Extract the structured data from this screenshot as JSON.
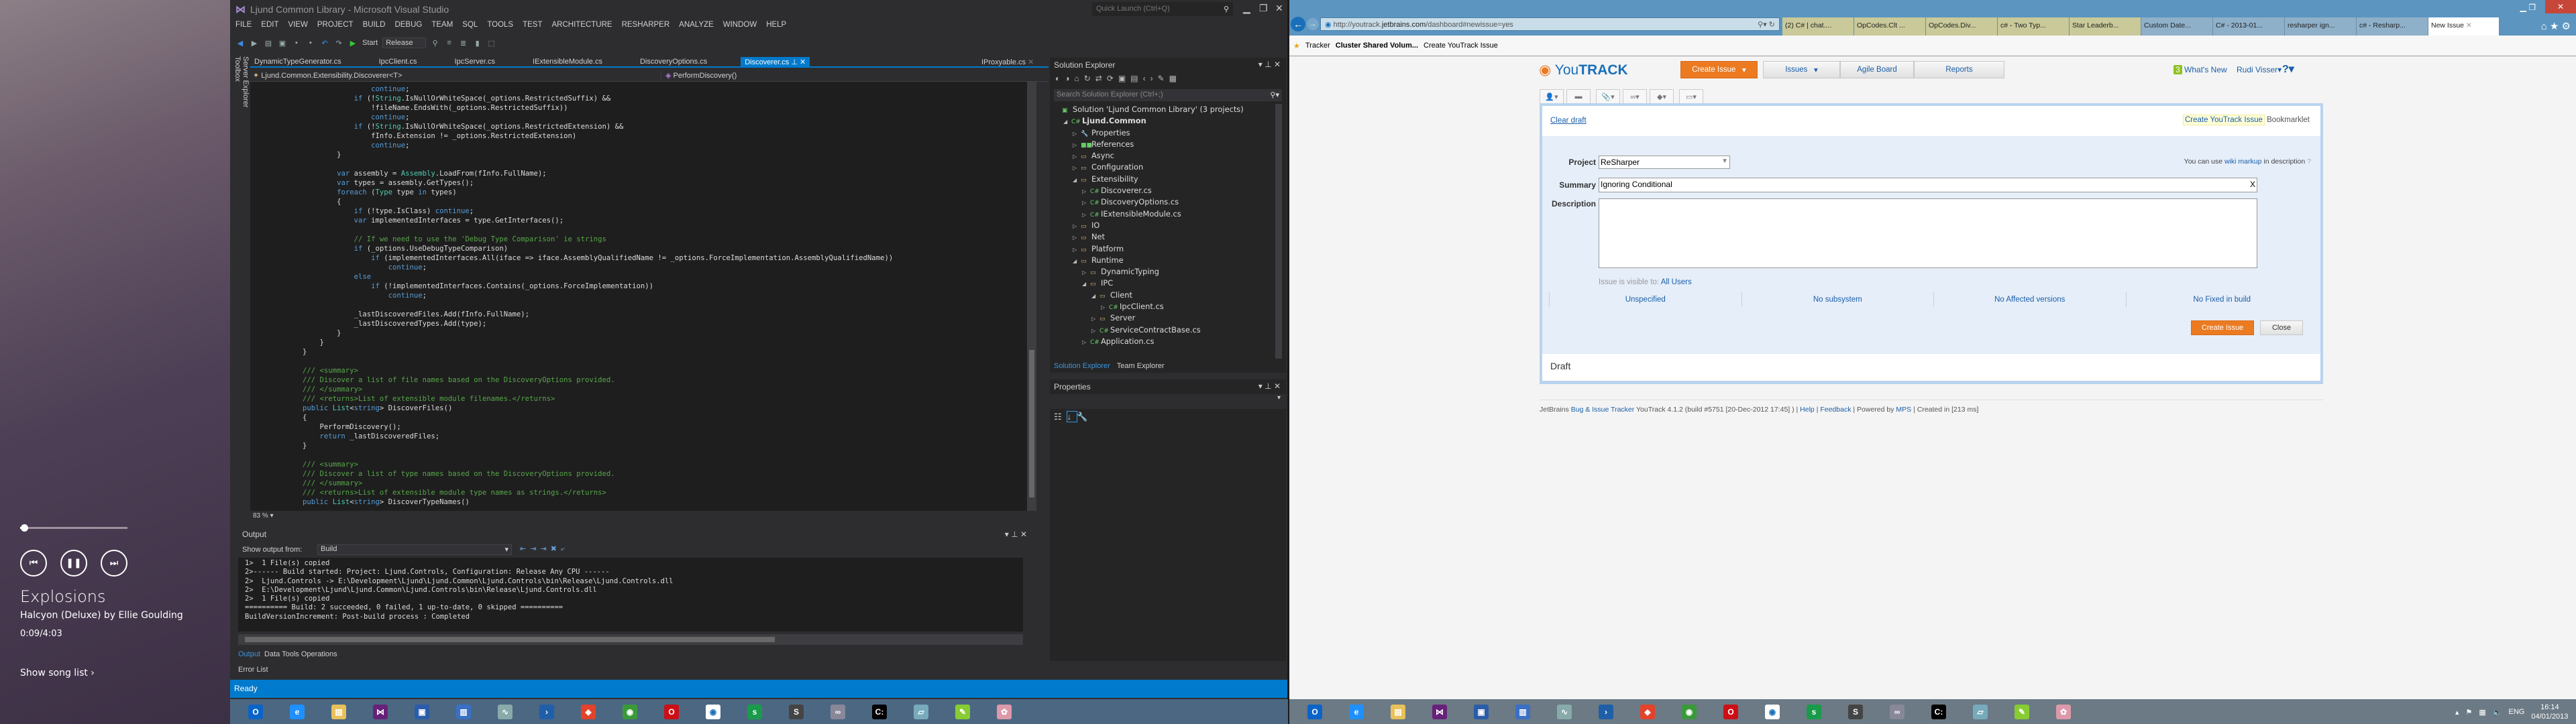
{
  "media": {
    "song": "Explosions",
    "album_line": "Halcyon (Deluxe) by Ellie Goulding",
    "time": "0:09/4:03",
    "progress_fraction": 0.037,
    "show_song_list": "Show song list ›",
    "prev_icon": "skip-previous-icon",
    "pause_icon": "pause-icon",
    "next_icon": "skip-next-icon"
  },
  "vs": {
    "title": "Ljund Common Library - Microsoft Visual Studio",
    "quick_launch": "Quick Launch (Ctrl+Q)",
    "menu": [
      "FILE",
      "EDIT",
      "VIEW",
      "PROJECT",
      "BUILD",
      "DEBUG",
      "TEAM",
      "SQL",
      "TOOLS",
      "TEST",
      "ARCHITECTURE",
      "RESHARPER",
      "ANALYZE",
      "WINDOW",
      "HELP"
    ],
    "toolbar": {
      "start": "Start",
      "config": "Release"
    },
    "side_tabs": [
      "Toolbox",
      "Server Explorer"
    ],
    "doc_tabs": [
      "DynamicTypeGenerator.cs",
      "IpcClient.cs",
      "IpcServer.cs",
      "IExtensibleModule.cs",
      "DiscoveryOptions.cs",
      "Discoverer.cs"
    ],
    "active_tab": "Discoverer.cs",
    "pinned_tab": "IProxyable.cs",
    "nav_type": "Ljund.Common.Extensibility.Discoverer<T>",
    "nav_member": "PerformDiscovery()",
    "zoom": "83 %",
    "status": "Ready"
  },
  "editor": {
    "lines": [
      {
        "i": 6,
        "tokens": [
          [
            "k",
            "continue"
          ],
          [
            "p",
            ";"
          ]
        ]
      },
      {
        "i": 5,
        "tokens": [
          [
            "k",
            "if"
          ],
          [
            "p",
            " (!"
          ],
          [
            "t",
            "String"
          ],
          [
            "p",
            ".IsNullOrWhiteSpace(_options.RestrictedSuffix) &&"
          ]
        ]
      },
      {
        "i": 6,
        "tokens": [
          [
            "p",
            "!fileName.EndsWith(_options.RestrictedSuffix))"
          ]
        ]
      },
      {
        "i": 6,
        "tokens": [
          [
            "k",
            "continue"
          ],
          [
            "p",
            ";"
          ]
        ]
      },
      {
        "i": 5,
        "tokens": [
          [
            "k",
            "if"
          ],
          [
            "p",
            " (!"
          ],
          [
            "t",
            "String"
          ],
          [
            "p",
            ".IsNullOrWhiteSpace(_options.RestrictedExtension) &&"
          ]
        ]
      },
      {
        "i": 6,
        "tokens": [
          [
            "p",
            "fInfo.Extension != _options.RestrictedExtension)"
          ]
        ]
      },
      {
        "i": 6,
        "tokens": [
          [
            "k",
            "continue"
          ],
          [
            "p",
            ";"
          ]
        ]
      },
      {
        "i": 4,
        "tokens": [
          [
            "p",
            "}"
          ]
        ]
      },
      {
        "i": 0,
        "tokens": []
      },
      {
        "i": 4,
        "tokens": [
          [
            "k",
            "var"
          ],
          [
            "p",
            " assembly = "
          ],
          [
            "t",
            "Assembly"
          ],
          [
            "p",
            ".LoadFrom(fInfo.FullName);"
          ]
        ]
      },
      {
        "i": 4,
        "tokens": [
          [
            "k",
            "var"
          ],
          [
            "p",
            " types = assembly.GetTypes();"
          ]
        ]
      },
      {
        "i": 4,
        "tokens": [
          [
            "k",
            "foreach"
          ],
          [
            "p",
            " ("
          ],
          [
            "t",
            "Type"
          ],
          [
            "p",
            " type "
          ],
          [
            "k",
            "in"
          ],
          [
            "p",
            " types)"
          ]
        ]
      },
      {
        "i": 4,
        "tokens": [
          [
            "p",
            "{"
          ]
        ]
      },
      {
        "i": 5,
        "tokens": [
          [
            "k",
            "if"
          ],
          [
            "p",
            " (!type.IsClass) "
          ],
          [
            "k",
            "continue"
          ],
          [
            "p",
            ";"
          ]
        ]
      },
      {
        "i": 5,
        "tokens": [
          [
            "k",
            "var"
          ],
          [
            "p",
            " implementedInterfaces = type.GetInterfaces();"
          ]
        ]
      },
      {
        "i": 0,
        "tokens": []
      },
      {
        "i": 5,
        "tokens": [
          [
            "c",
            "// If we need to use the 'Debug Type Comparison' ie strings"
          ]
        ]
      },
      {
        "i": 5,
        "tokens": [
          [
            "k",
            "if"
          ],
          [
            "p",
            " (_options.UseDebugTypeComparison)"
          ]
        ]
      },
      {
        "i": 6,
        "tokens": [
          [
            "k",
            "if"
          ],
          [
            "p",
            " (implementedInterfaces.All(iface => iface.AssemblyQualifiedName != _options.ForceImplementation.AssemblyQualifiedName))"
          ]
        ]
      },
      {
        "i": 7,
        "tokens": [
          [
            "k",
            "continue"
          ],
          [
            "p",
            ";"
          ]
        ]
      },
      {
        "i": 5,
        "tokens": [
          [
            "k",
            "else"
          ]
        ]
      },
      {
        "i": 6,
        "tokens": [
          [
            "k",
            "if"
          ],
          [
            "p",
            " (!implementedInterfaces.Contains(_options.ForceImplementation))"
          ]
        ]
      },
      {
        "i": 7,
        "tokens": [
          [
            "k",
            "continue"
          ],
          [
            "p",
            ";"
          ]
        ]
      },
      {
        "i": 0,
        "tokens": []
      },
      {
        "i": 5,
        "tokens": [
          [
            "p",
            "_lastDiscoveredFiles.Add(fInfo.FullName);"
          ]
        ]
      },
      {
        "i": 5,
        "tokens": [
          [
            "p",
            "_lastDiscoveredTypes.Add(type);"
          ]
        ]
      },
      {
        "i": 4,
        "tokens": [
          [
            "p",
            "}"
          ]
        ]
      },
      {
        "i": 3,
        "tokens": [
          [
            "p",
            "}"
          ]
        ]
      },
      {
        "i": 2,
        "tokens": [
          [
            "p",
            "}"
          ]
        ]
      },
      {
        "i": 0,
        "tokens": []
      },
      {
        "i": 2,
        "tokens": [
          [
            "c",
            "/// <summary>"
          ]
        ]
      },
      {
        "i": 2,
        "tokens": [
          [
            "c",
            "/// Discover a list of file names based on the DiscoveryOptions provided."
          ]
        ]
      },
      {
        "i": 2,
        "tokens": [
          [
            "c",
            "/// </summary>"
          ]
        ]
      },
      {
        "i": 2,
        "tokens": [
          [
            "c",
            "/// <returns>List of extensible module filenames.</returns>"
          ]
        ]
      },
      {
        "i": 2,
        "tokens": [
          [
            "k",
            "public"
          ],
          [
            "p",
            " "
          ],
          [
            "t",
            "List"
          ],
          [
            "p",
            "<"
          ],
          [
            "k",
            "string"
          ],
          [
            "p",
            "> DiscoverFiles()"
          ]
        ]
      },
      {
        "i": 2,
        "tokens": [
          [
            "p",
            "{"
          ]
        ]
      },
      {
        "i": 3,
        "tokens": [
          [
            "p",
            "PerformDiscovery();"
          ]
        ]
      },
      {
        "i": 3,
        "tokens": [
          [
            "k",
            "return"
          ],
          [
            "p",
            " _lastDiscoveredFiles;"
          ]
        ]
      },
      {
        "i": 2,
        "tokens": [
          [
            "p",
            "}"
          ]
        ]
      },
      {
        "i": 0,
        "tokens": []
      },
      {
        "i": 2,
        "tokens": [
          [
            "c",
            "/// <summary>"
          ]
        ]
      },
      {
        "i": 2,
        "tokens": [
          [
            "c",
            "/// Discover a list of type names based on the DiscoveryOptions provided."
          ]
        ]
      },
      {
        "i": 2,
        "tokens": [
          [
            "c",
            "/// </summary>"
          ]
        ]
      },
      {
        "i": 2,
        "tokens": [
          [
            "c",
            "/// <returns>List of extensible module type names as strings.</returns>"
          ]
        ]
      },
      {
        "i": 2,
        "tokens": [
          [
            "k",
            "public"
          ],
          [
            "p",
            " "
          ],
          [
            "t",
            "List"
          ],
          [
            "p",
            "<"
          ],
          [
            "k",
            "string"
          ],
          [
            "p",
            "> DiscoverTypeNames()"
          ]
        ]
      }
    ]
  },
  "output": {
    "title": "Output",
    "show_from_label": "Show output from:",
    "show_from_value": "Build",
    "lines": [
      "1>  1 File(s) copied",
      "2>------ Build started: Project: Ljund.Controls, Configuration: Release Any CPU ------",
      "2>  Ljund.Controls -> E:\\Development\\Ljund\\Ljund.Common\\Ljund.Controls\\bin\\Release\\Ljund.Controls.dll",
      "2>  E:\\Development\\Ljund\\Ljund.Common\\Ljund.Controls\\bin\\Release\\Ljund.Controls.dll",
      "2>  1 File(s) copied",
      "========== Build: 2 succeeded, 0 failed, 1 up-to-date, 0 skipped ==========",
      "BuildVersionIncrement: Post-build process : Completed"
    ],
    "tabs": [
      "Output",
      "Data Tools Operations"
    ],
    "error_list": "Error List"
  },
  "solution_explorer": {
    "title": "Solution Explorer",
    "search_placeholder": "Search Solution Explorer (Ctrl+;)",
    "items": [
      {
        "label": "Solution 'Ljund Common Library' (3 projects)",
        "level": 0,
        "state": "none",
        "kind": "solution"
      },
      {
        "label": "Ljund.Common",
        "level": 1,
        "state": "open",
        "kind": "project"
      },
      {
        "label": "Properties",
        "level": 2,
        "state": "closed",
        "kind": "properties"
      },
      {
        "label": "References",
        "level": 2,
        "state": "closed",
        "kind": "references"
      },
      {
        "label": "Async",
        "level": 2,
        "state": "closed",
        "kind": "folder"
      },
      {
        "label": "Configuration",
        "level": 2,
        "state": "closed",
        "kind": "folder"
      },
      {
        "label": "Extensibility",
        "level": 2,
        "state": "open",
        "kind": "folder"
      },
      {
        "label": "Discoverer.cs",
        "level": 3,
        "state": "closed",
        "kind": "cs"
      },
      {
        "label": "DiscoveryOptions.cs",
        "level": 3,
        "state": "closed",
        "kind": "cs"
      },
      {
        "label": "IExtensibleModule.cs",
        "level": 3,
        "state": "closed",
        "kind": "cs"
      },
      {
        "label": "IO",
        "level": 2,
        "state": "closed",
        "kind": "folder"
      },
      {
        "label": "Net",
        "level": 2,
        "state": "closed",
        "kind": "folder"
      },
      {
        "label": "Platform",
        "level": 2,
        "state": "closed",
        "kind": "folder"
      },
      {
        "label": "Runtime",
        "level": 2,
        "state": "open",
        "kind": "folder"
      },
      {
        "label": "DynamicTyping",
        "level": 3,
        "state": "closed",
        "kind": "folder"
      },
      {
        "label": "IPC",
        "level": 3,
        "state": "open",
        "kind": "folder"
      },
      {
        "label": "Client",
        "level": 4,
        "state": "open",
        "kind": "folder"
      },
      {
        "label": "IpcClient.cs",
        "level": 5,
        "state": "closed",
        "kind": "cs"
      },
      {
        "label": "Server",
        "level": 4,
        "state": "closed",
        "kind": "folder"
      },
      {
        "label": "ServiceContractBase.cs",
        "level": 4,
        "state": "closed",
        "kind": "cs"
      },
      {
        "label": "Application.cs",
        "level": 3,
        "state": "closed",
        "kind": "cs"
      }
    ],
    "tabs": [
      "Solution Explorer",
      "Team Explorer"
    ]
  },
  "properties": {
    "title": "Properties"
  },
  "taskbar_left": [
    "outlook",
    "internet-explorer",
    "file-explorer",
    "visual-studio",
    "remote-desktop",
    "network",
    "performance-monitor",
    "powershell",
    "git",
    "chrome",
    "opera",
    "youtrack",
    "sage",
    "sublime-text",
    "connections",
    "command-prompt",
    "notepad",
    "notepad-plus-plus",
    "paint"
  ],
  "taskbar_right": [
    "outlook",
    "internet-explorer",
    "file-explorer",
    "visual-studio",
    "remote-desktop",
    "network",
    "performance-monitor",
    "powershell",
    "git",
    "chrome",
    "opera",
    "youtrack",
    "sage",
    "sublime-text",
    "connections",
    "command-prompt",
    "notepad",
    "notepad-plus-plus",
    "paint"
  ],
  "tray": {
    "lang": "ENG",
    "time": "16:14",
    "date": "04/01/2013"
  },
  "browser": {
    "url_prefix": "http://youtrack.",
    "url_domain": "jetbrains.com",
    "url_path": "/dashboard#newissue=yes",
    "tabs": [
      "(2) C# | chat....",
      "OpCodes.Clt ...",
      "OpCodes.Div...",
      "c# - Two Typ...",
      "Star Leaderb...",
      "Custom Date...",
      "C# - 2013-01...",
      "resharper ign...",
      "c# - Resharp..."
    ],
    "active_tab": "New Issue",
    "favorites": [
      "Tracker",
      "Cluster Shared Volum...",
      "Create YouTrack Issue"
    ]
  },
  "youtrack": {
    "logo_you": "You",
    "logo_track": "TRACK",
    "nav": {
      "create_issue": "Create Issue",
      "issues": "Issues",
      "agile_board": "Agile Board",
      "reports": "Reports"
    },
    "whats_new_count": "3",
    "whats_new": "What's New",
    "user": "Rudi Visser",
    "help": "?",
    "clear_draft": "Clear draft",
    "bookmarklet_link": "Create YouTrack Issue",
    "bookmarklet_suffix": "Bookmarklet",
    "project_label": "Project",
    "project_value": "ReSharper",
    "markup_hint_pre": "You can use",
    "markup_hint_link": "wiki markup",
    "markup_hint_post": "in description",
    "summary_label": "Summary",
    "summary_value": "Ignoring Conditional",
    "description_label": "Description",
    "description_value": "",
    "visible_label": "Issue is visible to:",
    "visible_value": "All Users",
    "fields": [
      "Unspecified",
      "No subsystem",
      "No Affected versions",
      "No Fixed in build"
    ],
    "create_button": "Create Issue",
    "close_button": "Close",
    "draft": "Draft",
    "footer": {
      "jetbrains": "JetBrains",
      "tracker_link": "Bug & Issue Tracker",
      "version": "YouTrack 4.1.2 (build #5751 [20-Dec-2012 17:45] )",
      "help": "Help",
      "feedback": "Feedback",
      "powered": "Powered by",
      "mps": "MPS",
      "created": "Created in [213 ms]"
    }
  }
}
